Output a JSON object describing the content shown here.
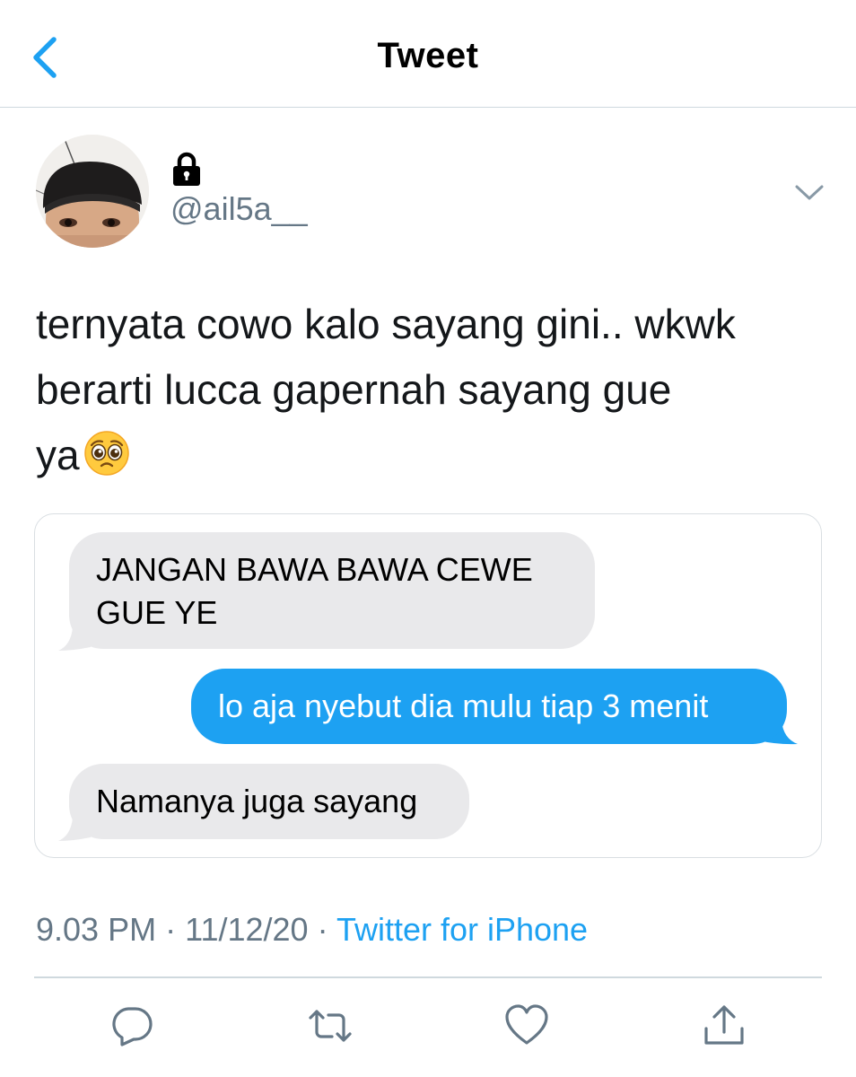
{
  "header": {
    "title": "Tweet",
    "back_icon": "chevron-left-icon"
  },
  "tweet": {
    "protected_icon": "lock-icon",
    "handle": "@ail5a__",
    "menu_icon": "chevron-down-icon",
    "text_lines": [
      "ternyata cowo kalo sayang gini.. wkwk",
      "berarti lucca gapernah sayang gue",
      "ya"
    ],
    "emoji": "pleading-face",
    "media": {
      "messages": [
        {
          "side": "received",
          "text": "JANGAN BAWA BAWA CEWE GUE YE"
        },
        {
          "side": "sent",
          "text": "lo aja nyebut dia mulu tiap 3 menit"
        },
        {
          "side": "received",
          "text": "Namanya juga sayang"
        }
      ]
    },
    "time": "9.03 PM",
    "date": "11/12/20",
    "separator": "·",
    "source": "Twitter for iPhone"
  },
  "actions": [
    "reply-icon",
    "retweet-icon",
    "like-icon",
    "share-icon"
  ],
  "colors": {
    "accent": "#1da1f2",
    "secondary_text": "#657786",
    "bubble_gray": "#e9e9eb"
  }
}
